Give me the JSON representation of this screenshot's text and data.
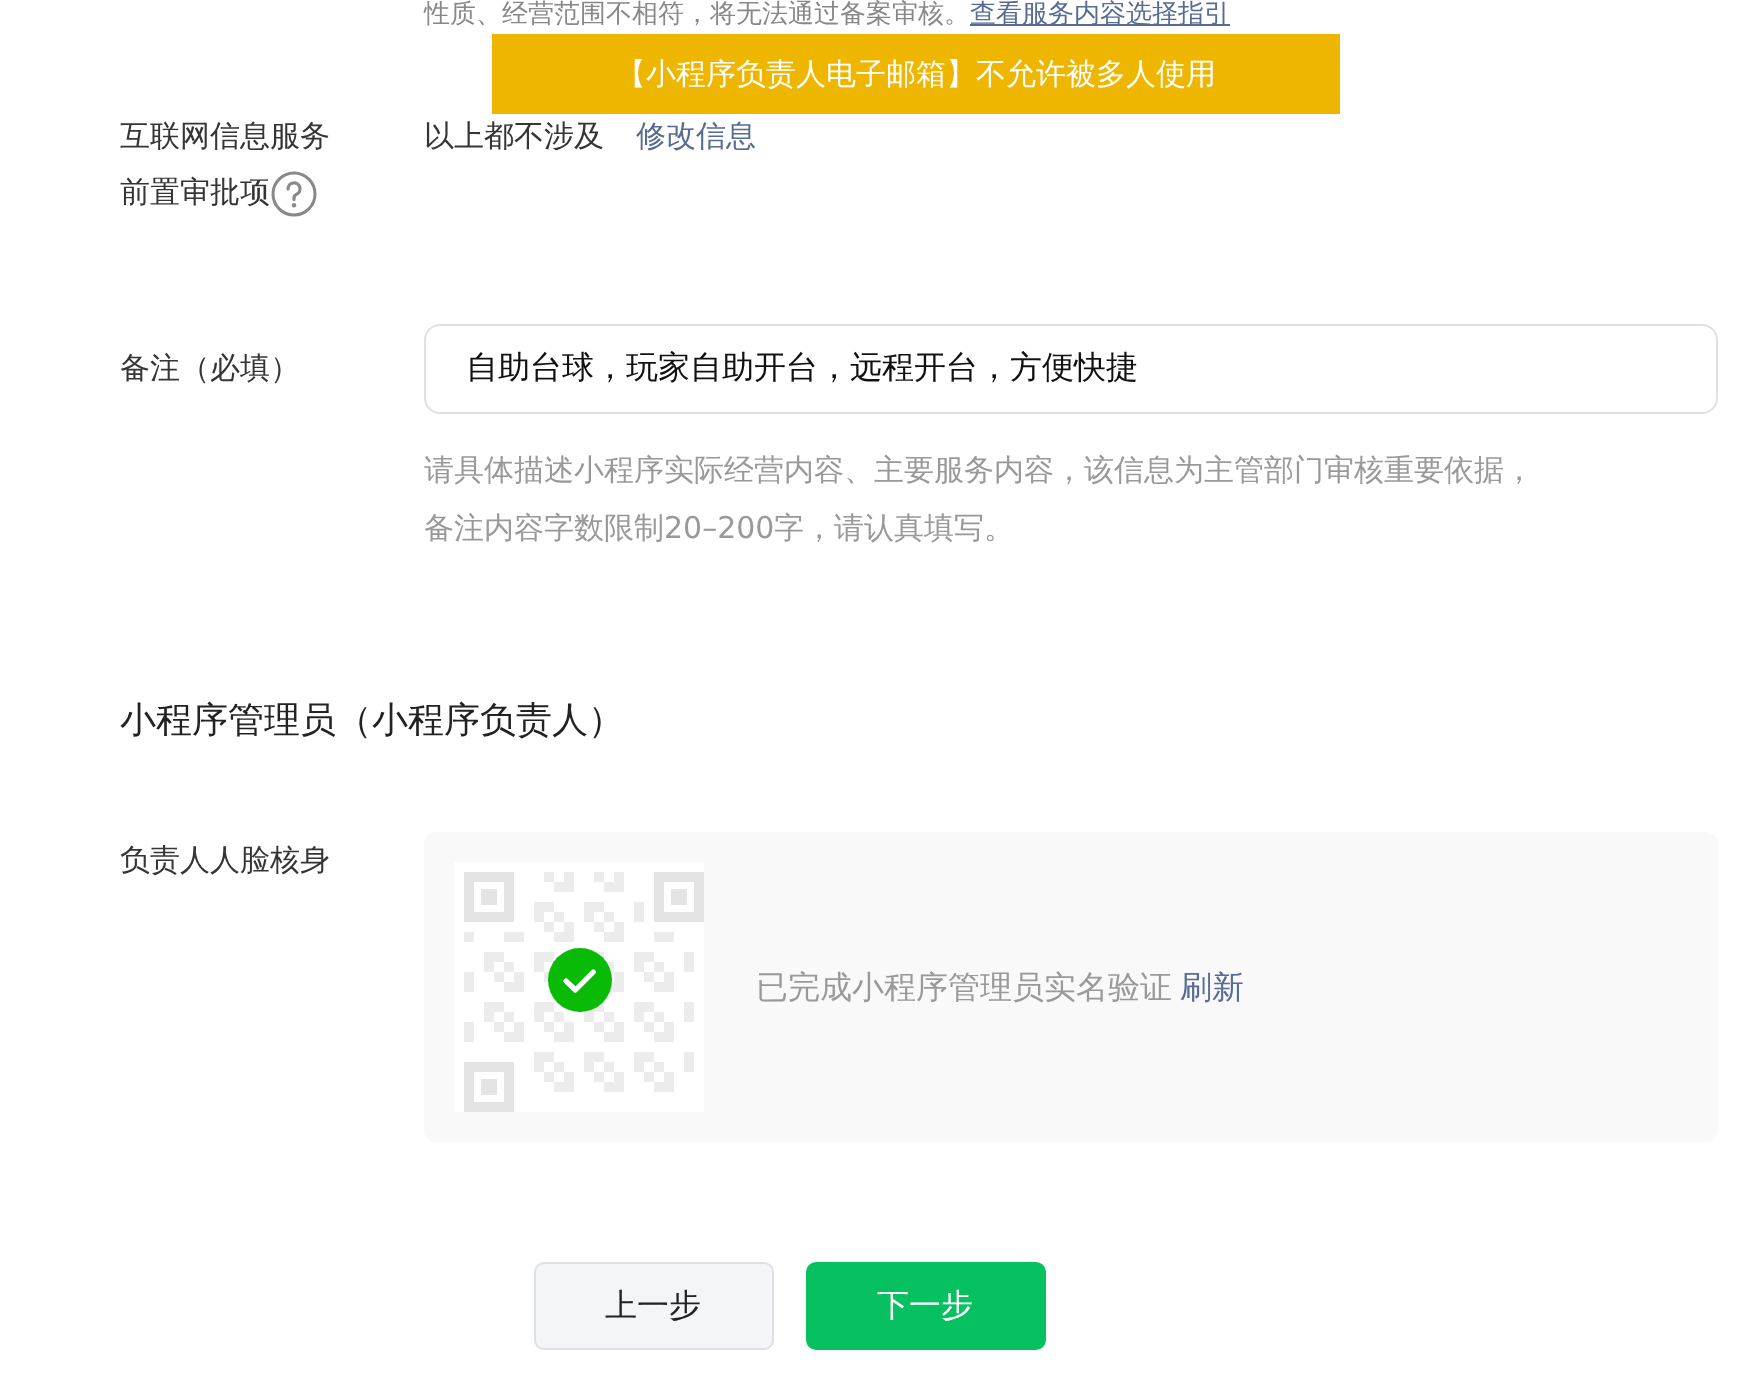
{
  "top_hint": {
    "text": "性质、经营范围不相符，将无法通过备案审核。",
    "link": "查看服务内容选择指引"
  },
  "toast": {
    "text": "【小程序负责人电子邮箱】不允许被多人使用"
  },
  "service_approval": {
    "label_lines": [
      "互联网信息服务",
      "前置审批项"
    ],
    "value": "以上都不涉及",
    "link": "修改信息"
  },
  "remark": {
    "label": "备注（必填）",
    "value": "自助台球，玩家自助开台，远程开台，方便快捷",
    "hint_lines": [
      "请具体描述小程序实际经营内容、主要服务内容，该信息为主管部门审核重要依据，",
      "备注内容字数限制20–200字，请认真填写。"
    ]
  },
  "section_title": "小程序管理员（小程序负责人）",
  "face_verify": {
    "label": "负责人人脸核身",
    "verified": true,
    "status": "已完成小程序管理员实名验证",
    "refresh": "刷新"
  },
  "buttons": [
    {
      "label": "上一步",
      "kind": "secondary"
    },
    {
      "label": "下一步",
      "kind": "primary"
    }
  ]
}
